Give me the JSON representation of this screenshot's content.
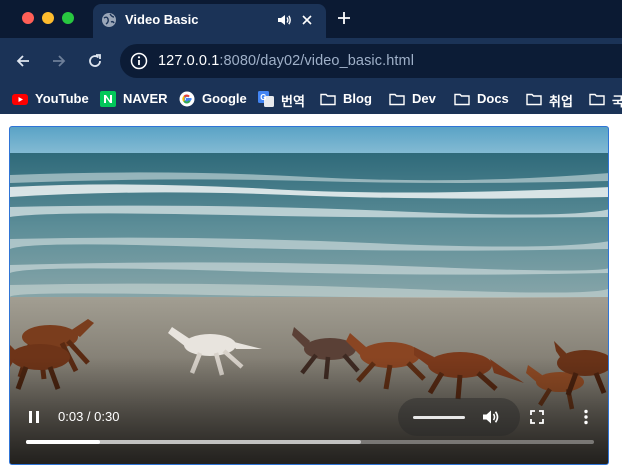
{
  "window": {
    "tab": {
      "title": "Video Basic",
      "favicon": "globe-icon",
      "audio_icon": "speaker-icon"
    }
  },
  "toolbar": {
    "url_host": "127.0.0.1",
    "url_rest": ":8080/day02/video_basic.html"
  },
  "bookmarks": [
    {
      "label": "YouTube",
      "icon": "youtube-icon"
    },
    {
      "label": "NAVER",
      "icon": "naver-icon"
    },
    {
      "label": "Google",
      "icon": "google-icon"
    },
    {
      "label": "번역",
      "icon": "translate-icon"
    },
    {
      "label": "Blog",
      "icon": "folder-icon"
    },
    {
      "label": "Dev",
      "icon": "folder-icon"
    },
    {
      "label": "Docs",
      "icon": "folder-icon"
    },
    {
      "label": "취업",
      "icon": "folder-icon"
    },
    {
      "label": "국",
      "icon": "folder-icon"
    }
  ],
  "video": {
    "current_time": "0:03",
    "duration": "0:30",
    "time_display": "0:03 / 0:30",
    "played_fraction": 0.13,
    "buffered_fraction": 0.59,
    "accent_color": "#2f74d6"
  }
}
